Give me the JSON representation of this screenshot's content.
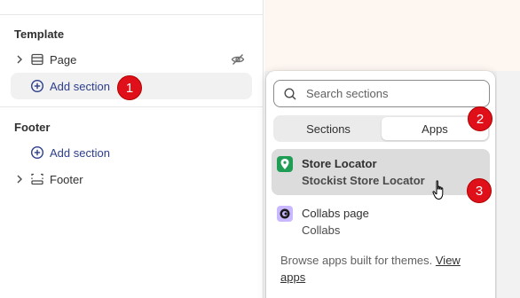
{
  "sidebar": {
    "template_title": "Template",
    "page_label": "Page",
    "add_section_label": "Add section",
    "footer_title": "Footer",
    "footer_add_section_label": "Add section",
    "footer_label": "Footer"
  },
  "popover": {
    "search_placeholder": "Search sections",
    "tabs": [
      {
        "label": "Sections",
        "active": false
      },
      {
        "label": "Apps",
        "active": true
      }
    ],
    "apps": [
      {
        "name": "Store Locator",
        "sub": "Stockist Store Locator",
        "icon": "map-pin-icon",
        "color": "#1f9d55"
      },
      {
        "name": "Collabs page",
        "sub": "Collabs",
        "icon": "collabs-icon",
        "color": "#b9a7ff"
      }
    ],
    "browse_text": "Browse apps built for themes.",
    "browse_link": "View apps"
  },
  "annotations": [
    "1",
    "2",
    "3"
  ],
  "colors": {
    "badge": "#e0101a",
    "link_blue": "#2c3e8c",
    "canvas": "#fdf6f1"
  }
}
